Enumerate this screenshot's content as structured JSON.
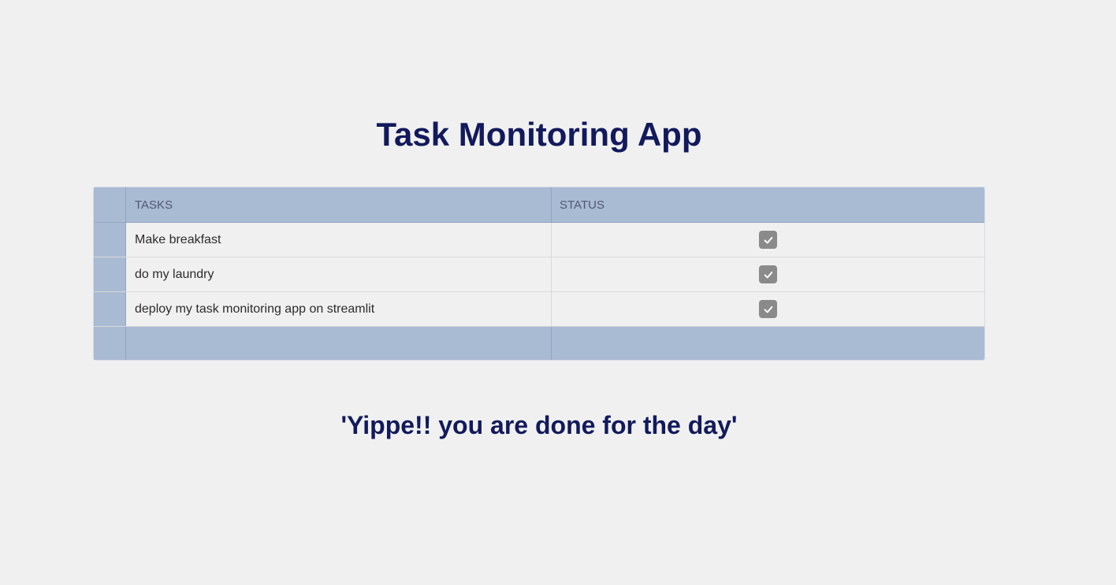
{
  "app": {
    "title": "Task Monitoring App"
  },
  "table": {
    "columns": [
      "TASKS",
      "STATUS"
    ],
    "rows": [
      {
        "task": "Make breakfast",
        "status": true
      },
      {
        "task": "do my laundry",
        "status": true
      },
      {
        "task": "deploy my task monitoring app on streamlit",
        "status": true
      }
    ]
  },
  "message": {
    "text": "'Yippe!! you are done for the day'"
  },
  "colors": {
    "title": "#121a5c",
    "header_bg": "#a9bad3",
    "background": "#f0f0f0",
    "checkbox": "#8a8a8a"
  },
  "icons": {
    "status_checked": "checkmark-icon"
  }
}
